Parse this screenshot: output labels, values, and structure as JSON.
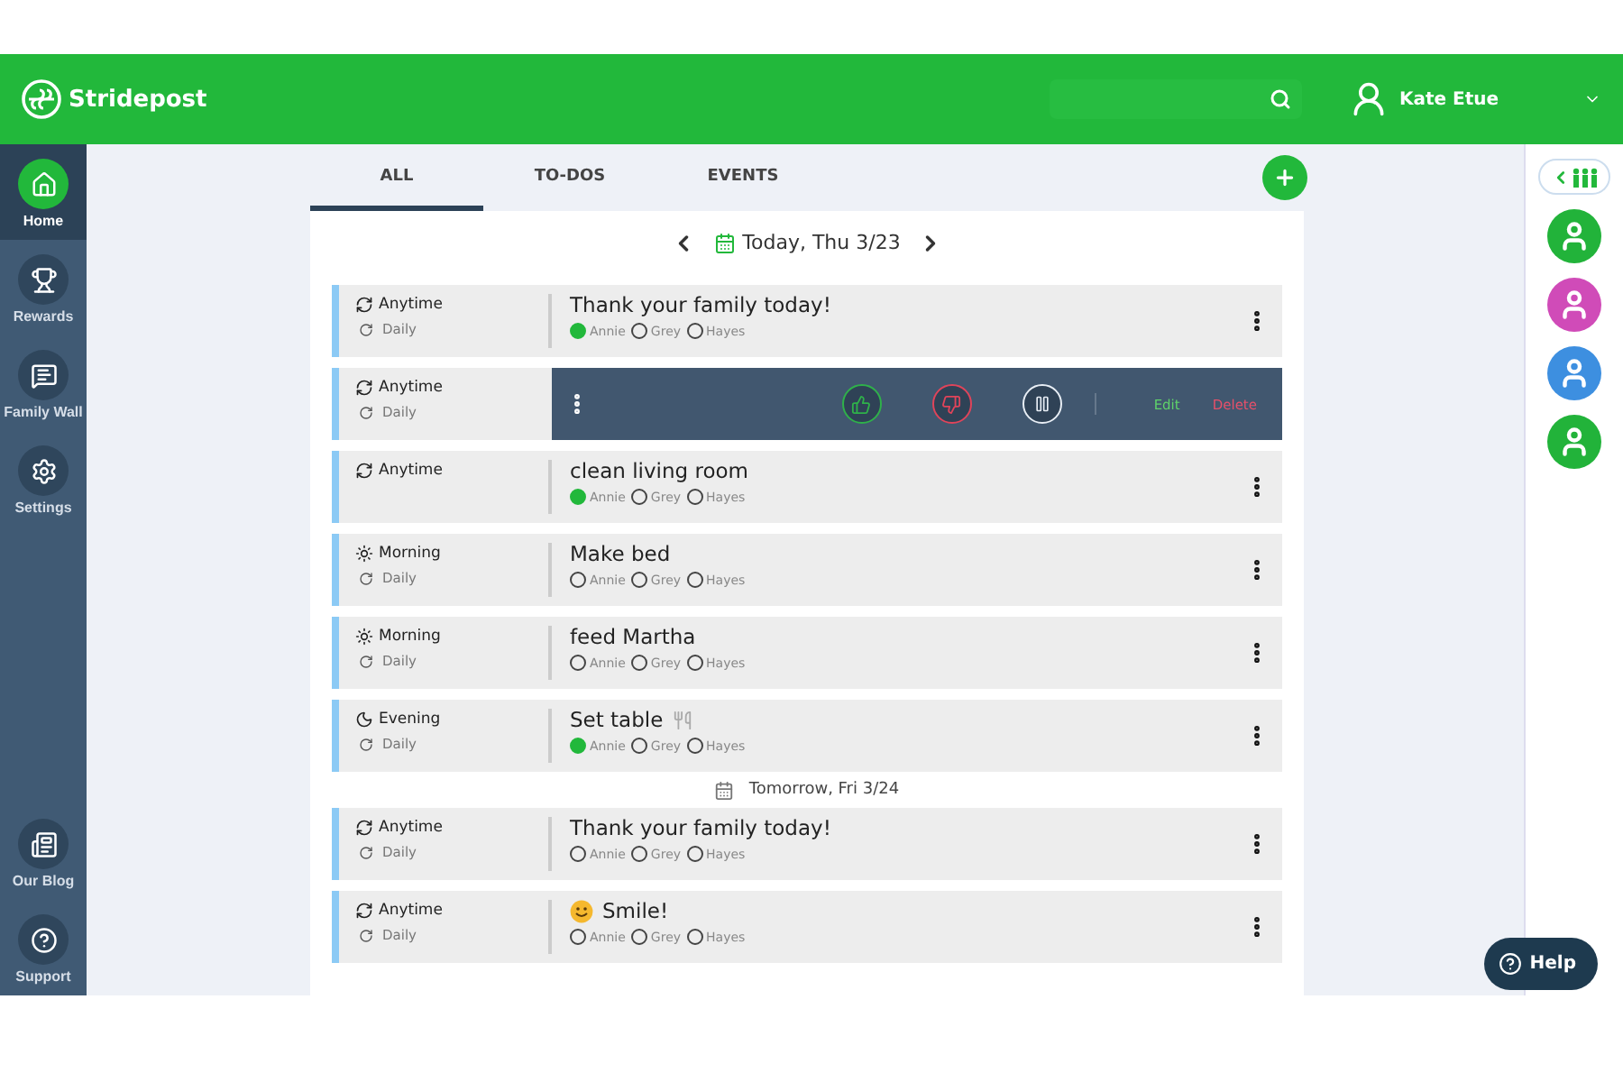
{
  "header": {
    "brand": "Stridepost",
    "user": "Kate Etue"
  },
  "sidebar": {
    "items": [
      {
        "label": "Home",
        "selected": true
      },
      {
        "label": "Rewards",
        "selected": false
      },
      {
        "label": "Family Wall",
        "selected": false
      },
      {
        "label": "Settings",
        "selected": false
      }
    ],
    "bottom_items": [
      {
        "label": "Our Blog"
      },
      {
        "label": "Support"
      }
    ]
  },
  "tabs": [
    {
      "label": "ALL",
      "selected": true
    },
    {
      "label": "TO-DOS",
      "selected": false
    },
    {
      "label": "EVENTS",
      "selected": false
    }
  ],
  "date_nav": {
    "label": "Today, Thu 3/23"
  },
  "rows": [
    {
      "kind": "task",
      "time": {
        "kind": "anytime",
        "label": "Anytime"
      },
      "repeat": "Daily",
      "title": "Thank your family today!",
      "assignees": [
        {
          "name": "Annie",
          "done": true
        },
        {
          "name": "Grey",
          "done": false
        },
        {
          "name": "Hayes",
          "done": false
        }
      ]
    },
    {
      "kind": "actions",
      "time": {
        "kind": "anytime",
        "label": "Anytime"
      },
      "repeat": "Daily",
      "edit": "Edit",
      "delete": "Delete"
    },
    {
      "kind": "task",
      "time": {
        "kind": "anytime",
        "label": "Anytime"
      },
      "title": "clean living room",
      "assignees": [
        {
          "name": "Annie",
          "done": true
        },
        {
          "name": "Grey",
          "done": false
        },
        {
          "name": "Hayes",
          "done": false
        }
      ]
    },
    {
      "kind": "task",
      "time": {
        "kind": "morning",
        "label": "Morning"
      },
      "repeat": "Daily",
      "title": "Make bed",
      "assignees": [
        {
          "name": "Annie",
          "done": false
        },
        {
          "name": "Grey",
          "done": false
        },
        {
          "name": "Hayes",
          "done": false
        }
      ]
    },
    {
      "kind": "task",
      "time": {
        "kind": "morning",
        "label": "Morning"
      },
      "repeat": "Daily",
      "title": "feed Martha",
      "assignees": [
        {
          "name": "Annie",
          "done": false
        },
        {
          "name": "Grey",
          "done": false
        },
        {
          "name": "Hayes",
          "done": false
        }
      ]
    },
    {
      "kind": "task",
      "time": {
        "kind": "evening",
        "label": "Evening"
      },
      "repeat": "Daily",
      "title": "Set table",
      "title_icon": {
        "kind": "utensils"
      },
      "assignees": [
        {
          "name": "Annie",
          "done": true
        },
        {
          "name": "Grey",
          "done": false
        },
        {
          "name": "Hayes",
          "done": false
        }
      ]
    },
    {
      "kind": "date",
      "label": "Tomorrow, Fri 3/24"
    },
    {
      "kind": "task",
      "time": {
        "kind": "anytime",
        "label": "Anytime"
      },
      "repeat": "Daily",
      "title": "Thank your family today!",
      "assignees": [
        {
          "name": "Annie",
          "done": false
        },
        {
          "name": "Grey",
          "done": false
        },
        {
          "name": "Hayes",
          "done": false
        }
      ]
    },
    {
      "kind": "task",
      "time": {
        "kind": "anytime",
        "label": "Anytime"
      },
      "repeat": "Daily",
      "title": "Smile!",
      "title_icon": {
        "kind": "smiley"
      },
      "assignees": [
        {
          "name": "Annie",
          "done": false
        },
        {
          "name": "Grey",
          "done": false
        },
        {
          "name": "Hayes",
          "done": false
        }
      ]
    }
  ],
  "members": [
    {
      "color": "#22b33a"
    },
    {
      "color": "#d04bb8"
    },
    {
      "color": "#3d8fe0"
    },
    {
      "color": "#22b33a"
    }
  ],
  "help": {
    "label": "Help"
  }
}
